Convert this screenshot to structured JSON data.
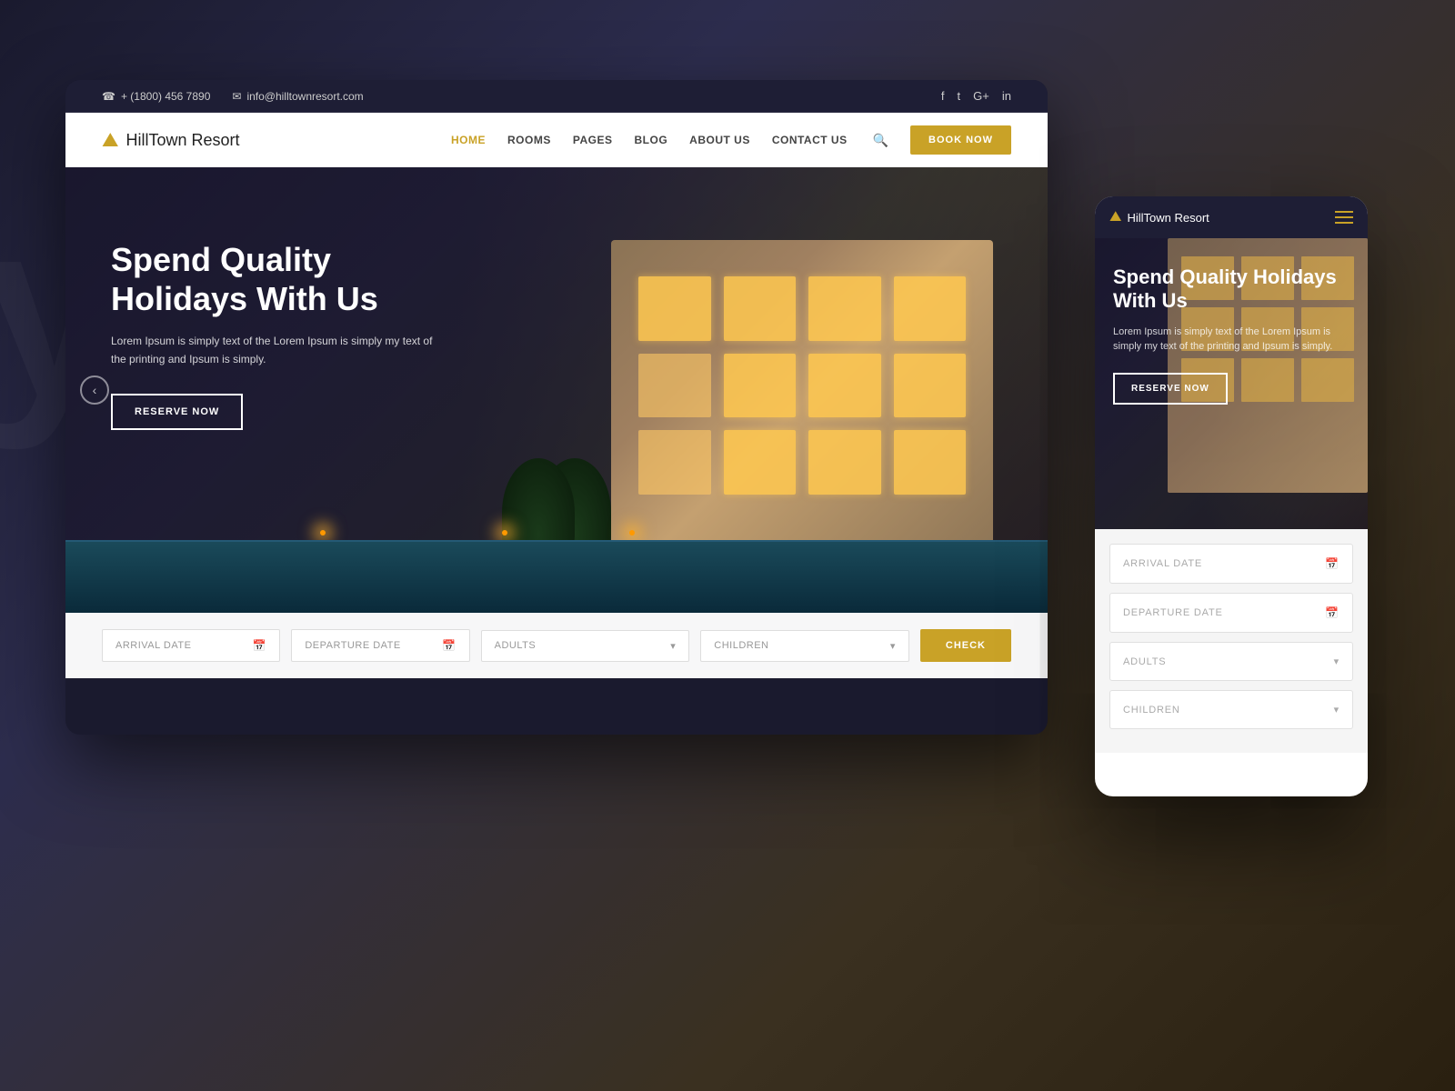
{
  "background": {
    "text": "ys"
  },
  "desktop": {
    "topbar": {
      "phone": "+ (1800) 456 7890",
      "email": "info@hilltownresort.com",
      "socials": [
        "f",
        "t",
        "G+",
        "in"
      ]
    },
    "nav": {
      "logo_name": "HillTown",
      "logo_suffix": " Resort",
      "links": [
        {
          "label": "HOME",
          "active": true
        },
        {
          "label": "ROOMS",
          "active": false
        },
        {
          "label": "PAGES",
          "active": false
        },
        {
          "label": "BLOG",
          "active": false
        },
        {
          "label": "ABOUT US",
          "active": false
        },
        {
          "label": "CONTACT US",
          "active": false
        }
      ],
      "book_now": "BOOK NOW"
    },
    "hero": {
      "title": "Spend Quality Holidays With Us",
      "description": "Lorem Ipsum is simply text of the Lorem Ipsum is simply my text of the printing and Ipsum is simply.",
      "cta": "RESERVE NOW"
    },
    "booking": {
      "arrival_placeholder": "ARRIVAL DATE",
      "departure_placeholder": "DEPARTURE DATE",
      "adults_placeholder": "ADULTS",
      "children_placeholder": "CHILDREN",
      "check_label": "CHECK"
    }
  },
  "mobile": {
    "nav": {
      "logo_name": "HillTown",
      "logo_suffix": " Resort"
    },
    "hero": {
      "title": "Spend Quality Holidays With Us",
      "description": "Lorem Ipsum is simply text of the Lorem Ipsum is simply my text of the printing and Ipsum is simply.",
      "cta": "RESERVE NOW"
    },
    "booking": {
      "arrival_placeholder": "ARRIVAL DATE",
      "departure_placeholder": "DEPARTURE DATE",
      "adults_placeholder": "ADULTS",
      "children_placeholder": "CHILDREN"
    }
  },
  "colors": {
    "gold": "#c9a227",
    "dark_nav": "#1e1e35",
    "white": "#ffffff"
  }
}
